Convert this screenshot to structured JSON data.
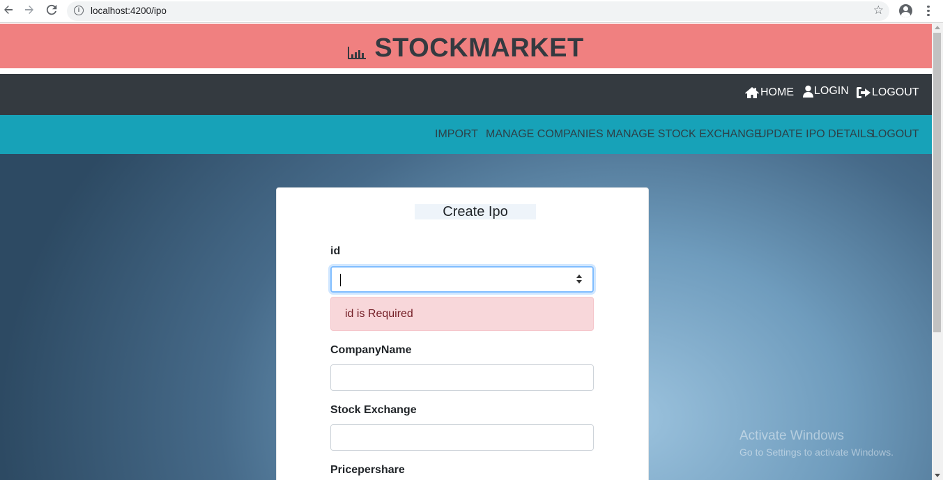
{
  "browser": {
    "url": "localhost:4200/ipo",
    "back_icon": "arrow-left-icon",
    "forward_icon": "arrow-right-icon",
    "reload_icon": "reload-icon"
  },
  "header": {
    "brand_title": "STOCKMARKET",
    "brand_icon": "bar-chart-icon",
    "brand_bg": "#f08080"
  },
  "top_nav": {
    "home": "HOME",
    "login": "LOGIN",
    "logout": "LOGOUT",
    "bg": "#343a40"
  },
  "admin_nav": {
    "items": [
      "IMPORT",
      "MANAGE COMPANIES",
      "MANAGE STOCK EXCHANGE",
      "UPDATE IPO DETAILS",
      "LOGOUT"
    ],
    "bg": "#17a2b8"
  },
  "form": {
    "title": "Create Ipo",
    "id_label": "id",
    "id_value": "",
    "id_error": "id is Required",
    "company_label": "CompanyName",
    "company_value": "",
    "exchange_label": "Stock Exchange",
    "exchange_value": "",
    "price_label": "Pricepershare"
  },
  "watermark": {
    "line1": "Activate Windows",
    "line2": "Go to Settings to activate Windows."
  }
}
